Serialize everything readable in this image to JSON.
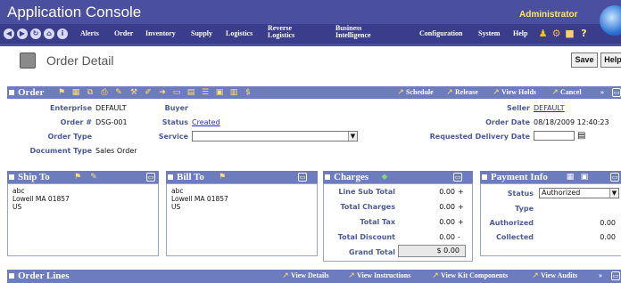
{
  "app": {
    "title": "Application Console",
    "user": "Administrator"
  },
  "nav": {
    "items": [
      "Alerts",
      "Order",
      "Inventory",
      "Supply",
      "Logistics"
    ],
    "reverse_logistics": [
      "Reverse",
      "Logistics"
    ],
    "business_intelligence": [
      "Business",
      "Intelligence"
    ],
    "right_items": [
      "Configuration",
      "System",
      "Help"
    ]
  },
  "page": {
    "title": "Order Detail",
    "save_label": "Save",
    "help_label": "Help"
  },
  "order": {
    "section_title": "Order",
    "actions": [
      "Schedule",
      "Release",
      "View Holds",
      "Cancel"
    ],
    "more": "»",
    "fields": {
      "enterprise_label": "Enterprise",
      "enterprise_value": "DEFAULT",
      "order_no_label": "Order #",
      "order_no_value": "DSG-001",
      "order_type_label": "Order Type",
      "document_type_label": "Document Type",
      "document_type_value": "Sales Order",
      "buyer_label": "Buyer",
      "status_label": "Status",
      "status_value": "Created",
      "service_label": "Service",
      "seller_label": "Seller",
      "seller_value": "DEFAULT",
      "order_date_label": "Order Date",
      "order_date_value": "08/18/2009 12:40:23",
      "requested_delivery_label": "Requested Delivery Date"
    }
  },
  "ship_to": {
    "title": "Ship To",
    "lines": [
      "abc",
      "Lowell MA 01857",
      "US"
    ]
  },
  "bill_to": {
    "title": "Bill To",
    "lines": [
      "abc",
      "Lowell MA 01857",
      "US"
    ]
  },
  "charges": {
    "title": "Charges",
    "rows": [
      {
        "label": "Line Sub Total",
        "value": "0.00",
        "sign": "+"
      },
      {
        "label": "Total Charges",
        "value": "0.00",
        "sign": "+"
      },
      {
        "label": "Total Tax",
        "value": "0.00",
        "sign": "+"
      },
      {
        "label": "Total Discount",
        "value": "0.00",
        "sign": "-"
      }
    ],
    "grand_total_label": "Grand Total",
    "grand_total_value": "$ 0.00"
  },
  "payment": {
    "title": "Payment Info",
    "status_label": "Status",
    "status_value": "Authorized",
    "type_label": "Type",
    "authorized_label": "Authorized",
    "authorized_value": "0.00",
    "collected_label": "Collected",
    "collected_value": "0.00"
  },
  "order_lines": {
    "title": "Order Lines",
    "actions": [
      "View Details",
      "View Instructions",
      "View Kit Components",
      "View Audits"
    ],
    "more": "»"
  }
}
